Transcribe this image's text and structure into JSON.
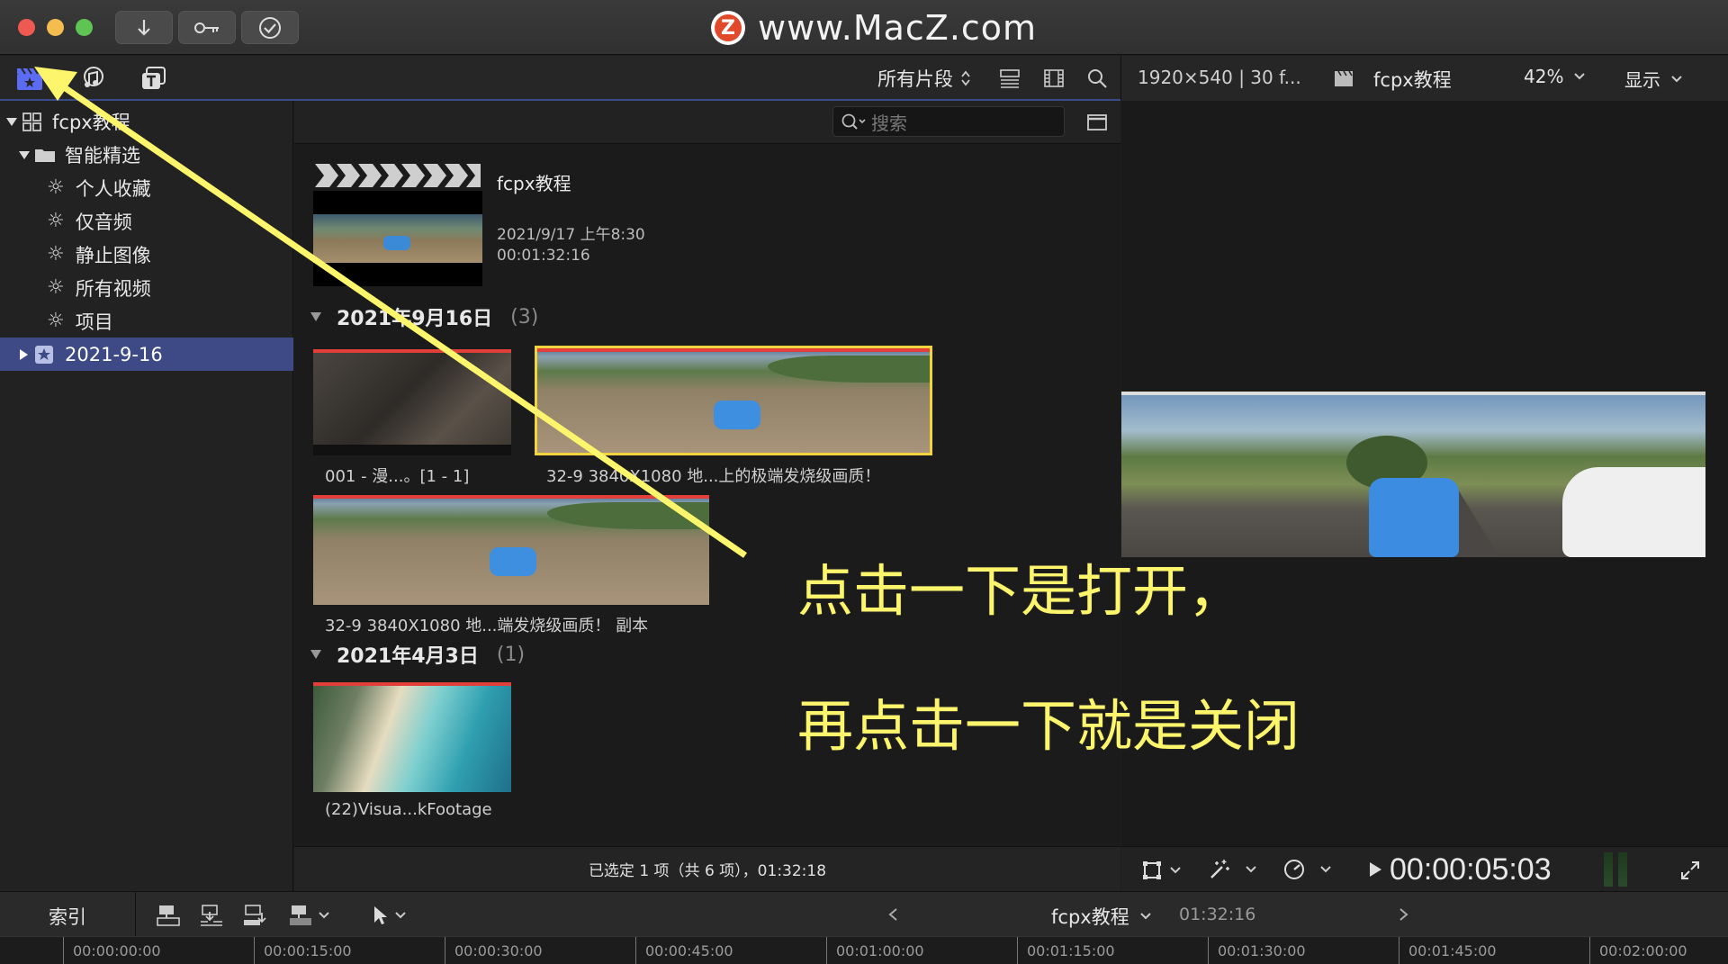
{
  "window": {
    "site_title": "www.MacZ.com",
    "site_logo_letter": "Z",
    "traffic_lights": [
      "#ee5a52",
      "#f5bd4f",
      "#5fc453"
    ],
    "toolbar_buttons": [
      "import-icon",
      "keyword-icon",
      "checkmark-icon"
    ]
  },
  "toolbar": {
    "filter_label": "所有片段",
    "viewer_info": "1920×540 | 30 f...",
    "project_name": "fcpx教程",
    "zoom": "42%",
    "display_label": "显示"
  },
  "search": {
    "placeholder": "搜索"
  },
  "sidebar": {
    "items": [
      {
        "label": "fcpx教程",
        "icon": "library-icon",
        "level": 0
      },
      {
        "label": "智能精选",
        "icon": "folder-icon",
        "level": 1
      },
      {
        "label": "个人收藏",
        "icon": "gear-icon",
        "level": 2
      },
      {
        "label": "仅音频",
        "icon": "gear-icon",
        "level": 2
      },
      {
        "label": "静止图像",
        "icon": "gear-icon",
        "level": 2
      },
      {
        "label": "所有视频",
        "icon": "gear-icon",
        "level": 2
      },
      {
        "label": "项目",
        "icon": "gear-icon",
        "level": 2
      },
      {
        "label": "2021-9-16",
        "icon": "event-star-icon",
        "level": 1,
        "selected": true
      }
    ]
  },
  "browser": {
    "project": {
      "name": "fcpx教程",
      "date": "2021/9/17 上午8:30",
      "duration": "00:01:32:16"
    },
    "groups": [
      {
        "title": "2021年9月16日",
        "count": "(3)",
        "clips": [
          {
            "label": "001 - 漫...。[1 - 1]"
          },
          {
            "label": "32-9 3840X1080 地...上的极端发烧级画质！",
            "selected": true
          },
          {
            "label": "32-9 3840X1080 地...端发烧级画质！ 副本"
          }
        ]
      },
      {
        "title": "2021年4月3日",
        "count": "(1)",
        "clips": [
          {
            "label": "(22)Visua...kFootage"
          }
        ]
      }
    ],
    "footer": "已选定 1 项（共 6 项），01:32:18"
  },
  "viewer": {
    "timecode": "00:00:05:03"
  },
  "timeline": {
    "index_label": "索引",
    "project_name": "fcpx教程",
    "duration": "01:32:16",
    "ruler": [
      "00:00:00:00",
      "00:00:15:00",
      "00:00:30:00",
      "00:00:45:00",
      "00:01:00:00",
      "00:01:15:00",
      "00:01:30:00",
      "00:01:45:00",
      "00:02:00:00"
    ]
  },
  "annotation": {
    "line1": "点击一下是打开，",
    "line2": "再点击一下就是关闭",
    "color": "#fdf56b"
  }
}
